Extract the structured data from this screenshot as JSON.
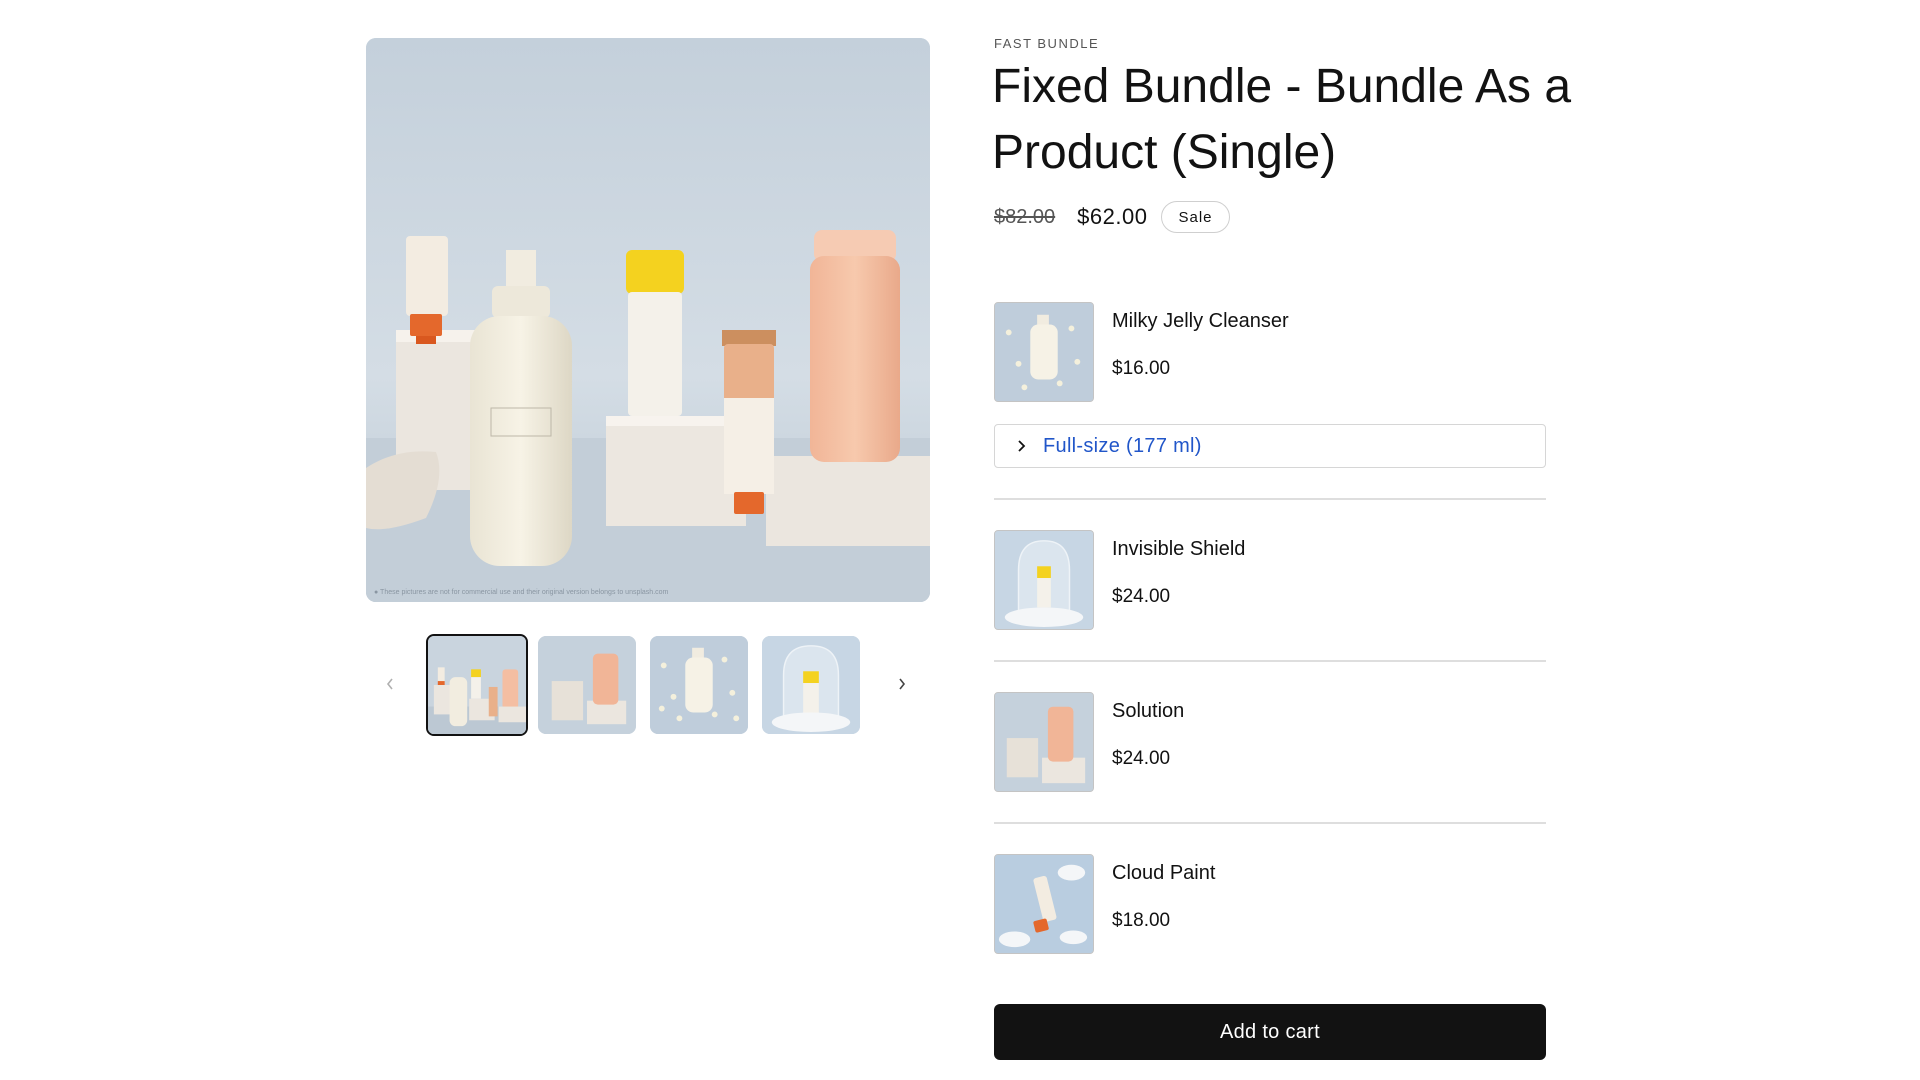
{
  "gallery": {
    "main_image_alt": "Skincare bundle product photo",
    "caption": "These pictures are not for commercial use and their original version belongs to unsplash.com",
    "thumbnails": [
      {
        "name": "bundle-group-thumbnail"
      },
      {
        "name": "solution-thumbnail"
      },
      {
        "name": "milky-jelly-thumbnail"
      },
      {
        "name": "invisible-shield-thumbnail"
      }
    ],
    "prev_icon": "chevron-left-icon",
    "next_icon": "chevron-right-icon"
  },
  "product": {
    "vendor": "FAST BUNDLE",
    "title": "Fixed Bundle - Bundle As a Product (Single)",
    "compare_price": "$82.00",
    "price": "$62.00",
    "badge": "Sale"
  },
  "bundle_items": [
    {
      "name": "Milky Jelly Cleanser",
      "price": "$16.00",
      "variant": "Full-size (177 ml)"
    },
    {
      "name": "Invisible Shield",
      "price": "$24.00"
    },
    {
      "name": "Solution",
      "price": "$24.00"
    },
    {
      "name": "Cloud Paint",
      "price": "$18.00"
    }
  ],
  "actions": {
    "add_to_cart": "Add to cart"
  },
  "colors": {
    "text": "#121212",
    "link": "#2156c9",
    "button_bg": "#121212",
    "button_text": "#ffffff",
    "divider": "#dedede"
  }
}
